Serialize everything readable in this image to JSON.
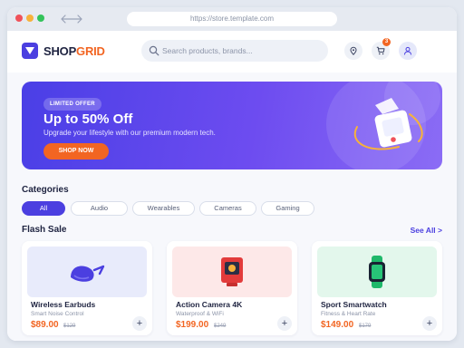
{
  "browser": {
    "url": "https://store.template.com"
  },
  "brand": {
    "name_part1": "SHOP",
    "name_part2": "GRID",
    "primary_color": "#4b3fe0",
    "accent_color": "#f26522"
  },
  "header": {
    "search_placeholder": "Search products, brands...",
    "cart_count": "3",
    "icons": [
      "search-icon",
      "location-pin-icon",
      "cart-icon",
      "user-icon"
    ]
  },
  "hero": {
    "badge": "LIMITED OFFER",
    "title": "Up to 50% Off",
    "subtitle": "Upgrade your lifestyle with our premium modern tech.",
    "button": "SHOP NOW"
  },
  "categories": {
    "title": "Categories",
    "items": [
      "All",
      "Audio",
      "Wearables",
      "Cameras",
      "Gaming"
    ],
    "selected": "All"
  },
  "flash_sale": {
    "title": "Flash Sale",
    "see_all": "See All >",
    "products": [
      {
        "name": "Wireless Earbuds",
        "desc": "Smart Noise Control",
        "price": "$89.00",
        "old_price": "$129",
        "icon": "earbuds-icon",
        "bg": "#e8ebfb"
      },
      {
        "name": "Action Camera 4K",
        "desc": "Waterproof & WiFi",
        "price": "$199.00",
        "old_price": "$249",
        "icon": "camera-icon",
        "bg": "#fde8e8"
      },
      {
        "name": "Sport Smartwatch",
        "desc": "Fitness & Heart Rate",
        "price": "$149.00",
        "old_price": "$179",
        "icon": "smartwatch-icon",
        "bg": "#e3f7ec"
      }
    ],
    "add_label": "+"
  }
}
